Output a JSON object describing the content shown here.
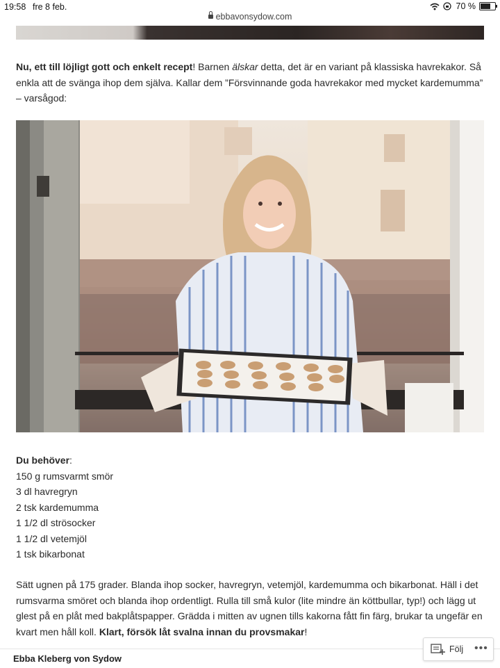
{
  "status": {
    "time": "19:58",
    "date": "fre 8 feb.",
    "battery": "70 %",
    "battery_level": 0.7
  },
  "browser": {
    "url": "ebbavonsydow.com"
  },
  "article": {
    "intro_bold": "Nu, ett till löjligt gott och enkelt recept",
    "intro_rest1": "! Barnen ",
    "intro_em": "älskar",
    "intro_rest2": " detta, det är en variant på klassiska havrekakor. Så enkla att de svänga ihop dem själva. Kallar dem ”Försvinnande goda havrekakor med mycket kardemumma” – varsågod:",
    "ingredients_heading": "Du behöver",
    "ingredients_colon": ":",
    "ingredients": [
      "150 g rumsvarmt smör",
      "3 dl havregryn",
      "2 tsk kardemumma",
      "1 1/2 dl strösocker",
      "1 1/2 dl vetemjöl",
      "1 tsk bikarbonat"
    ],
    "instructions": "Sätt ugnen på 175 grader. Blanda ihop socker, havregryn, vetemjöl, kardemumma och bikarbonat. Häll i det rumsvarma smöret och blanda ihop ordentligt. Rulla till små kulor (lite mindre än köttbullar, typ!) och lägg ut glest på en plåt med bakplåtspapper. Grädda i mitten av ugnen tills kakorna fått fin färg, brukar ta ungefär en kvart men håll koll. ",
    "instructions_bold": "Klart, försök låt svalna innan du provsmakar",
    "instructions_end": "!"
  },
  "footer": {
    "site_name": "Ebba Kleberg von Sydow",
    "follow_label": "Följ",
    "more": "•••"
  }
}
